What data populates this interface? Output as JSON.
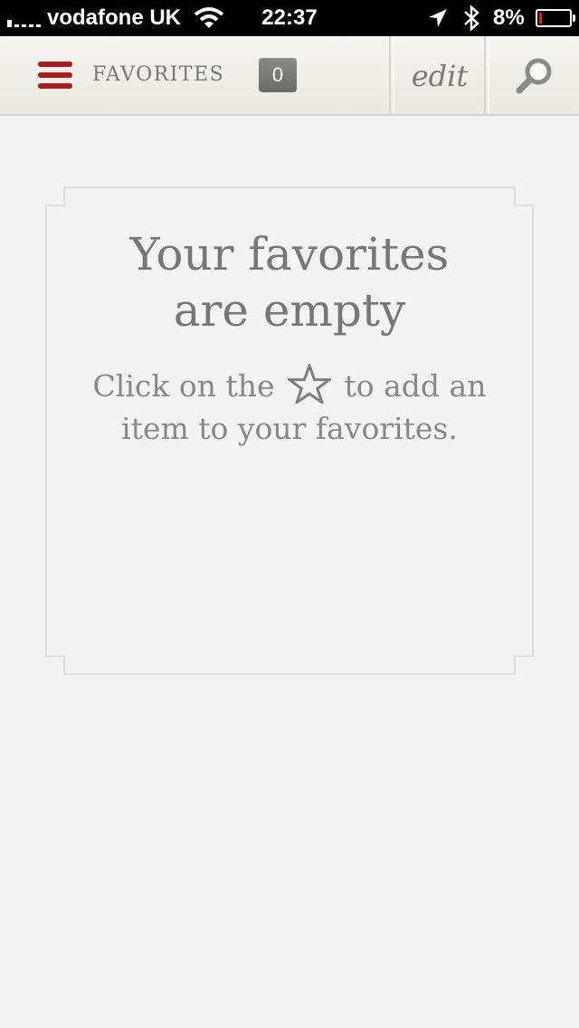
{
  "status_bar": {
    "carrier": "vodafone UK",
    "time": "22:37",
    "battery_percent": "8%",
    "battery_level": 0.08,
    "signal_icon": "signal-bars-icon",
    "wifi_icon": "wifi-icon",
    "location_icon": "location-arrow-icon",
    "bluetooth_icon": "bluetooth-icon",
    "battery_icon": "battery-icon"
  },
  "nav": {
    "menu_icon": "hamburger-menu-icon",
    "title": "FAVORITES",
    "count": "0",
    "edit_label": "edit",
    "search_icon": "magnifier-icon"
  },
  "empty_state": {
    "title_line1": "Your favorites",
    "title_line2": "are empty",
    "text_before_icon": "Click on the",
    "text_after_icon": "to add an",
    "text_line2": "item to your favorites.",
    "icon": "star-outline-icon"
  },
  "colors": {
    "accent": "#a51d1d",
    "background": "#f3f3f3",
    "text": "#777777",
    "badge": "#7a7a77"
  }
}
